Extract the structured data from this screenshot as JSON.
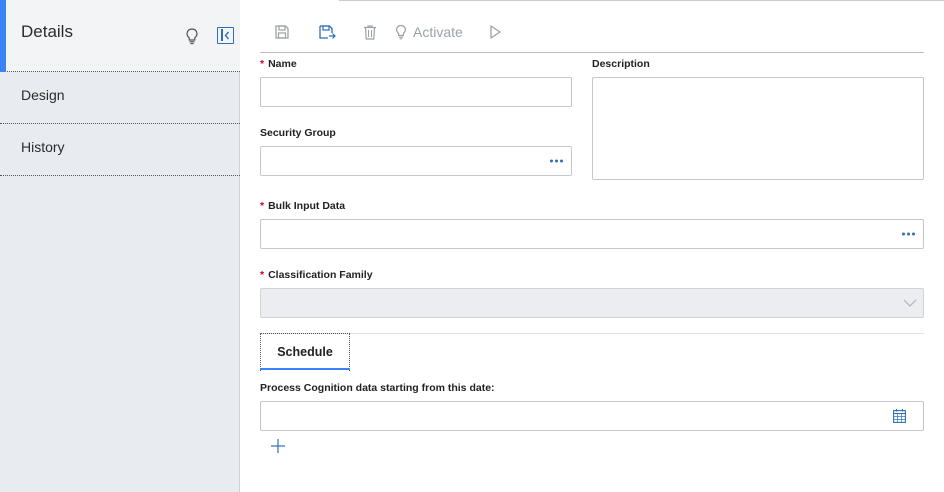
{
  "sidebar": {
    "title": "Details",
    "items": [
      {
        "label": "Design"
      },
      {
        "label": "History"
      }
    ]
  },
  "toolbar": {
    "activate_label": "Activate"
  },
  "form": {
    "name": {
      "label": "Name",
      "required": "*",
      "value": ""
    },
    "description": {
      "label": "Description",
      "value": ""
    },
    "security_group": {
      "label": "Security Group",
      "value": ""
    },
    "bulk_input_data": {
      "label": "Bulk Input Data",
      "required": "*",
      "value": ""
    },
    "classification_family": {
      "label": "Classification Family",
      "required": "*",
      "value": ""
    }
  },
  "tabs": [
    {
      "label": "Schedule"
    }
  ],
  "schedule": {
    "start_date_label": "Process Cognition data starting from this date:",
    "start_date_value": ""
  },
  "colors": {
    "accent": "#3b82f6",
    "required": "#d0021b",
    "icon_blue": "#2f6fb7"
  },
  "icons": [
    "lightbulb-icon",
    "collapse-panel-icon",
    "save-icon",
    "save-as-icon",
    "trash-icon",
    "activate-bulb-icon",
    "play-icon",
    "more-dots-icon",
    "chevron-down-icon",
    "calendar-icon",
    "plus-icon"
  ]
}
